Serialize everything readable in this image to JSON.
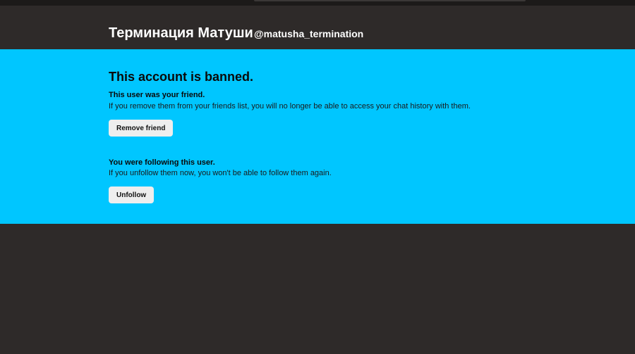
{
  "header": {
    "display_name": "Терминация Матуши",
    "username": "@matusha_termination"
  },
  "banner": {
    "title": "This account is banned.",
    "friend_section": {
      "title": "This user was your friend.",
      "text": "If you remove them from your friends list, you will no longer be able to access your chat history with them.",
      "button_label": "Remove friend"
    },
    "follow_section": {
      "title": "You were following this user.",
      "text": "If you unfollow them now, you won't be able to follow them again.",
      "button_label": "Unfollow"
    },
    "background_color": "#00c6ff"
  },
  "page": {
    "background_color": "#2e2a29"
  }
}
